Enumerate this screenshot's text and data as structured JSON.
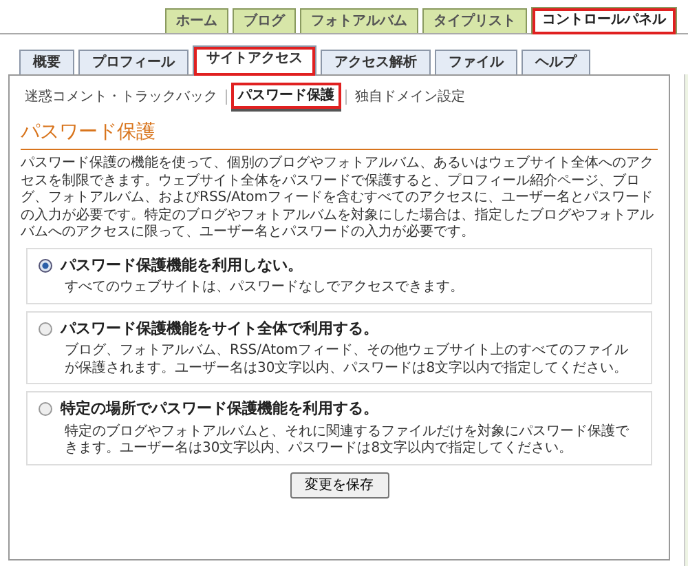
{
  "top_tabs": [
    {
      "label": "ホーム",
      "selected": false,
      "highlighted": false
    },
    {
      "label": "ブログ",
      "selected": false,
      "highlighted": false
    },
    {
      "label": "フォトアルバム",
      "selected": false,
      "highlighted": false
    },
    {
      "label": "タイプリスト",
      "selected": false,
      "highlighted": false
    },
    {
      "label": "コントロールパネル",
      "selected": true,
      "highlighted": true
    }
  ],
  "section_tabs": [
    {
      "label": "概要",
      "selected": false,
      "highlighted": false
    },
    {
      "label": "プロフィール",
      "selected": false,
      "highlighted": false
    },
    {
      "label": "サイトアクセス",
      "selected": true,
      "highlighted": true
    },
    {
      "label": "アクセス解析",
      "selected": false,
      "highlighted": false
    },
    {
      "label": "ファイル",
      "selected": false,
      "highlighted": false
    },
    {
      "label": "ヘルプ",
      "selected": false,
      "highlighted": false
    }
  ],
  "sub_nav": [
    {
      "label": "迷惑コメント・トラックバック",
      "selected": false,
      "highlighted": false
    },
    {
      "label": "パスワード保護",
      "selected": true,
      "highlighted": true
    },
    {
      "label": "独自ドメイン設定",
      "selected": false,
      "highlighted": false
    }
  ],
  "heading": "パスワード保護",
  "intro": "パスワード保護の機能を使って、個別のブログやフォトアルバム、あるいはウェブサイト全体へのアクセスを制限できます。ウェブサイト全体をパスワードで保護すると、プロフィール紹介ページ、ブログ、フォトアルバム、およびRSS/Atomフィードを含むすべてのアクセスに、ユーザー名とパスワードの入力が必要です。特定のブログやフォトアルバムを対象にした場合は、指定したブログやフォトアルバムへのアクセスに限って、ユーザー名とパスワードの入力が必要です。",
  "options": [
    {
      "label": "パスワード保護機能を利用しない。",
      "description": "すべてのウェブサイトは、パスワードなしでアクセスできます。",
      "selected": true
    },
    {
      "label": "パスワード保護機能をサイト全体で利用する。",
      "description": "ブログ、フォトアルバム、RSS/Atomフィード、その他ウェブサイト上のすべてのファイルが保護されます。ユーザー名は30文字以内、パスワードは8文字以内で指定してください。",
      "selected": false
    },
    {
      "label": "特定の場所でパスワード保護機能を利用する。",
      "description": "特定のブログやフォトアルバムと、それに関連するファイルだけを対象にパスワード保護できます。ユーザー名は30文字以内、パスワードは8文字以内で指定してください。",
      "selected": false
    }
  ],
  "save_button": "変更を保存"
}
